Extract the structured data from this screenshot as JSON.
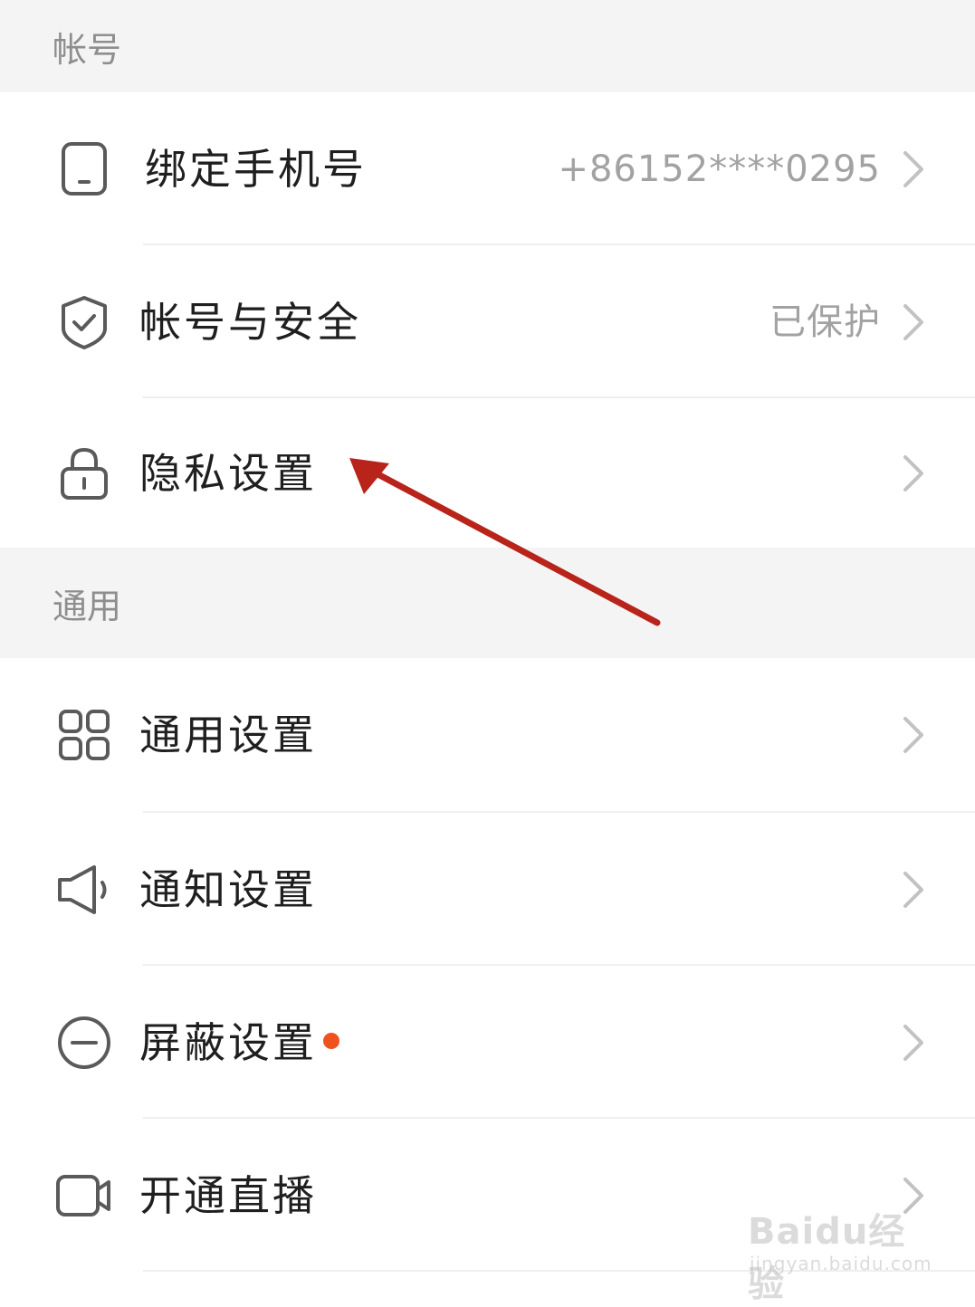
{
  "sections": {
    "account": {
      "title": "帐号"
    },
    "general": {
      "title": "通用"
    }
  },
  "rows": {
    "bind_phone": {
      "label": "绑定手机号",
      "value": "+86152****0295",
      "icon": "phone-icon"
    },
    "account_security": {
      "label": "帐号与安全",
      "value": "已保护",
      "icon": "shield-check-icon"
    },
    "privacy": {
      "label": "隐私设置",
      "icon": "lock-icon"
    },
    "general_settings": {
      "label": "通用设置",
      "icon": "grid-icon"
    },
    "notification": {
      "label": "通知设置",
      "icon": "speaker-icon"
    },
    "block": {
      "label": "屏蔽设置",
      "icon": "minus-circle-icon",
      "badge": "red-dot"
    },
    "live": {
      "label": "开通直播",
      "icon": "video-camera-icon"
    }
  },
  "watermark": {
    "main": "Baidu经验",
    "sub": "jingyan.baidu.com"
  },
  "colors": {
    "section_bg": "#f4f4f4",
    "section_text": "#8e8e8e",
    "label_text": "#1f1f1f",
    "value_text": "#a2a2a2",
    "icon_stroke": "#5a5a5a",
    "chevron": "#c2c2c2",
    "badge": "#f0521f",
    "annotation_arrow": "#b8231a"
  }
}
